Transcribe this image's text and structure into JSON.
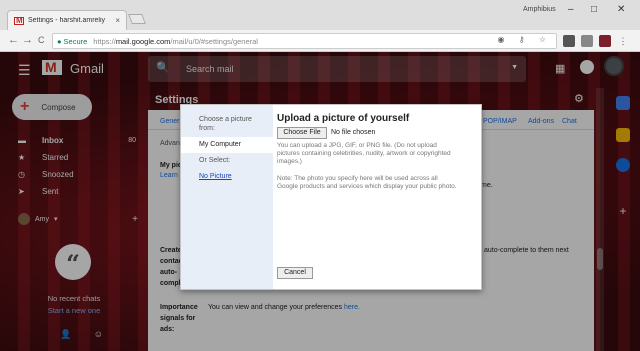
{
  "browser": {
    "tab_title": "Settings - harshit.amreliy",
    "tab_close": "×",
    "profile_name": "Amphibius",
    "win_minimize": "–",
    "win_maximize": "□",
    "win_close": "✕",
    "back": "←",
    "forward": "→",
    "reload": "C",
    "lock": "🔒",
    "secure_label": "Secure",
    "url_scheme": "https://",
    "url_host": "mail.google.com",
    "url_path": "/mail/u/0/#settings/general",
    "omni_icons": "◉ ⚷ ☆"
  },
  "gmail": {
    "menu_icon": "☰",
    "wordmark": "Gmail",
    "search_icon": "🔍",
    "search_placeholder": "Search mail",
    "search_dropdown": "▼",
    "apps_icon": "⋮⋮⋮",
    "compose_plus": "+",
    "compose_label": "Compose",
    "nav": [
      {
        "icon": "▬",
        "label": "Inbox",
        "count": "80"
      },
      {
        "icon": "★",
        "label": "Starred",
        "count": ""
      },
      {
        "icon": "◷",
        "label": "Snoozed",
        "count": ""
      },
      {
        "icon": "➤",
        "label": "Sent",
        "count": ""
      }
    ],
    "user_name": "Amy",
    "user_dropdown": "▾",
    "user_add": "+",
    "hangouts_quote": "“",
    "no_recent_chats": "No recent chats",
    "start_new": "Start a new one",
    "bottom_person": "👤",
    "bottom_chat": "☺",
    "settings_title": "Settings",
    "gear_icon": "⚙",
    "tabs": [
      "Gener",
      "POP/IMAP",
      "Add-ons",
      "Chat"
    ],
    "advanced_tab": "Advan",
    "my_picture_label": "My pic",
    "learn_link": "Learn",
    "me_text": "me.",
    "create_label_lines": [
      "Create",
      "contac",
      "auto-",
      "compl"
    ],
    "autocomplete_text": "auto-complete to them next",
    "importance_lines": [
      "Importance",
      "signals for",
      "ads:"
    ],
    "importance_text": "You can view and change your preferences",
    "here_link": "here."
  },
  "dialog": {
    "choose_from": "Choose a picture from:",
    "my_computer": "My Computer",
    "or_select": "Or Select:",
    "no_picture": "No Picture",
    "title": "Upload a picture of yourself",
    "choose_file": "Choose File",
    "no_file": "No file chosen",
    "para1": "You can upload a JPG, GIF, or PNG file. (Do not upload pictures containing celebrities, nudity, artwork or copyrighted images.)",
    "para2": "Note: The photo you specify here will be used across all Google products and services which display your public photo.",
    "cancel": "Cancel"
  }
}
